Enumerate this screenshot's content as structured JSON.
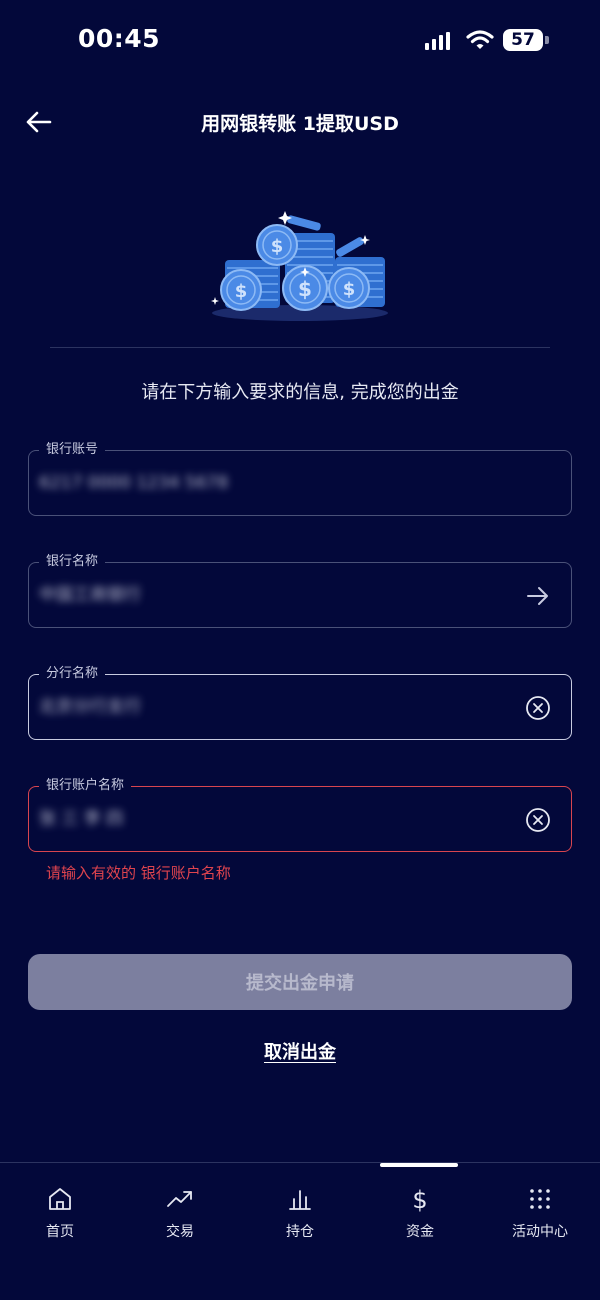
{
  "status": {
    "time": "00:45",
    "battery": "57"
  },
  "header": {
    "title": "用网银转账 1提取USD"
  },
  "instruction": "请在下方输入要求的信息, 完成您的出金",
  "fields": [
    {
      "label": "银行账号",
      "value": "6217 0000 1234 5678"
    },
    {
      "label": "银行名称",
      "value": "中国工商银行"
    },
    {
      "label": "分行名称",
      "value": "北京分行支行"
    },
    {
      "label": "银行账户名称",
      "value": "张 三 李 四"
    }
  ],
  "error_message": "请输入有效的 银行账户名称",
  "submit_label": "提交出金申请",
  "cancel_label": "取消出金",
  "nav": [
    {
      "label": "首页",
      "icon": "home-icon"
    },
    {
      "label": "交易",
      "icon": "trend-icon"
    },
    {
      "label": "持仓",
      "icon": "bar-chart-icon"
    },
    {
      "label": "资金",
      "icon": "dollar-icon"
    },
    {
      "label": "活动中心",
      "icon": "grid-dots-icon"
    }
  ],
  "colors": {
    "background": "#03083a",
    "error": "#e0444e",
    "button_disabled": "#7c7f9f"
  }
}
